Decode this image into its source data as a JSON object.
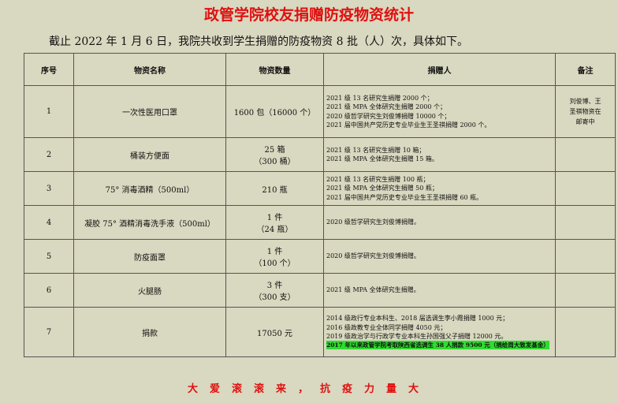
{
  "title": "政管学院校友捐赠防疫物资统计",
  "intro": "截止 2022 年 1 月 6 日，我院共收到学生捐赠的防疫物资 8 批（人）次，具体如下。",
  "headers": [
    "序号",
    "物资名称",
    "物资数量",
    "捐赠人",
    "备注"
  ],
  "rows": [
    {
      "no": "1",
      "name": "一次性医用口罩",
      "qty": [
        "1600 包（16000 个）"
      ],
      "donors": [
        "2021 级 13 名研究生捐赠 2000 个；",
        "2021 级 MPA 全体研究生捐赠 2000 个；",
        "2020 级哲学研究生刘俊博捐赠 10000 个；",
        "2021 届中国共产党历史专业毕业生王圣祺捐赠 2000 个。"
      ],
      "note": [
        "刘俊博、王",
        "圣祺物资在",
        "邮寄中"
      ]
    },
    {
      "no": "2",
      "name": "桶装方便面",
      "qty": [
        "25 箱",
        "（300 桶）"
      ],
      "donors": [
        "2021 级 13 名研究生捐赠 10 箱；",
        "2021 级 MPA 全体研究生捐赠 15 箱。"
      ],
      "note": []
    },
    {
      "no": "3",
      "name": "75° 消毒酒精（500ml）",
      "qty": [
        "210 瓶"
      ],
      "donors": [
        "2021 级 13 名研究生捐赠 100 瓶；",
        "2021 级 MPA 全体研究生捐赠 50 瓶；",
        "2021 届中国共产党历史专业毕业生王圣祺捐赠 60 瓶。"
      ],
      "note": []
    },
    {
      "no": "4",
      "name": "凝胶 75° 酒精消毒洗手液（500ml）",
      "qty": [
        "1 件",
        "（24 瓶）"
      ],
      "donors": [
        "2020 级哲学研究生刘俊博捐赠。"
      ],
      "note": []
    },
    {
      "no": "5",
      "name": "防疫面罩",
      "qty": [
        "1 件",
        "（100 个）"
      ],
      "donors": [
        "2020 级哲学研究生刘俊博捐赠。"
      ],
      "note": []
    },
    {
      "no": "6",
      "name": "火腿肠",
      "qty": [
        "3 件",
        "（300 支）"
      ],
      "donors": [
        "2021 级 MPA 全体研究生捐赠。"
      ],
      "note": []
    },
    {
      "no": "7",
      "name": "捐款",
      "qty": [
        "17050 元"
      ],
      "donors": [
        "2014 级政行专业本科生、2018 届选调生李小霞捐赠 1000 元；",
        "2016 级政教专业全体同学捐赠 4050 元；",
        "2019 级政治学与行政学专业本科生孙国强父子捐赠 12000 元。"
      ],
      "donor_highlight": "2017 年以来政管学院考取陕西省选调生 38 人捐款 9500 元（捐给周大致发基金）",
      "note": []
    }
  ],
  "slogan": "大爱滚滚来，抗疫力量大",
  "colors": {
    "background": "#d9d8c0",
    "title": "#e01010",
    "highlight": "#2fdc2f"
  }
}
